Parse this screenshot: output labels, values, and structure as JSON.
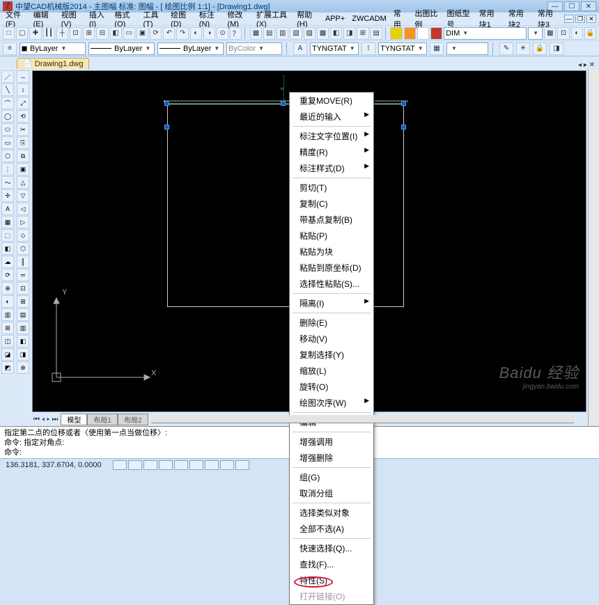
{
  "titlebar": {
    "app_icon": "Z",
    "title": "中望CAD机械版2014 - 主图幅  标准: 图幅 - [ 绘图比例 1:1] - [Drawing1.dwg]"
  },
  "menubar": {
    "items": [
      "文件(F)",
      "编辑(E)",
      "视图(V)",
      "插入(I)",
      "格式(O)",
      "工具(T)",
      "绘图(D)",
      "标注(N)",
      "修改(M)",
      "扩展工具(X)",
      "帮助(H)",
      "APP+",
      "ZWCADM",
      "常 用",
      "出图比例",
      "图纸型号",
      "常用块1",
      "常用块2",
      "常用块3"
    ]
  },
  "toolbar_row1": {
    "buttons": [
      "□",
      "▢",
      "✚",
      "┃┃",
      "┼",
      "⊡",
      "⊞",
      "⊟",
      "◧",
      "▭",
      "▣",
      "⟳",
      "↶",
      "↷",
      "◐",
      "◑",
      "⊙",
      "？"
    ],
    "buttons2": [
      "▦",
      "▤",
      "▥",
      "▧",
      "▨",
      "▩",
      "◧",
      "◨",
      "⊞",
      "▤"
    ],
    "combo1": "",
    "combo2": "DIM",
    "end_icons": [
      "▦",
      "⊡",
      "◐",
      "🔒"
    ]
  },
  "layer_row": {
    "combo_color": "ByLayer",
    "combo_ltype": "ByLayer",
    "combo_lweight": "ByLayer",
    "combo_color2": "ByColor",
    "combo_ts1": "TYNGTAT",
    "combo_ts2": "TYNGTAT",
    "layer_icons": [
      "✎",
      "☀",
      "🔒",
      "◨"
    ]
  },
  "doctab": {
    "name": "Drawing1.dwg"
  },
  "left_tools": [
    "／",
    "╲",
    "⌒",
    "◯",
    "⬭",
    "▭",
    "⬡",
    "⋮",
    "～",
    "✢",
    "A",
    "▦",
    "⬚",
    "◧",
    "☁",
    "⟳",
    "⊕",
    "◐",
    "▥",
    "⊞",
    "◫",
    "◪",
    "◩"
  ],
  "left_tools2": [
    "↔",
    "↕",
    "⤢",
    "⟲",
    "✂",
    "⎘",
    "⧉",
    "▣",
    "△",
    "▽",
    "◁",
    "▷",
    "◇",
    "⬡",
    "║",
    "═",
    "⊡",
    "⊞",
    "▤",
    "▥",
    "◧",
    "◨",
    "⊕"
  ],
  "bottom_tabs": {
    "model": "模型",
    "layout1": "布局1",
    "layout2": "布局2"
  },
  "command": {
    "line1": "指定第二点的位移或者〈使用第一点当做位移〉:",
    "line2": "命令: 指定对角点:",
    "line3": "命令:",
    "prompt": "命令:"
  },
  "status": {
    "coords": "136.3181, 337.6704, 0.0000"
  },
  "context_menu": {
    "items": [
      {
        "label": "重复MOVE(R)",
        "sub": false
      },
      {
        "label": "最近的输入",
        "sub": true
      },
      {
        "sep": true
      },
      {
        "label": "标注文字位置(I)",
        "sub": true
      },
      {
        "label": "精度(R)",
        "sub": true
      },
      {
        "label": "标注样式(D)",
        "sub": true
      },
      {
        "sep": true
      },
      {
        "label": "剪切(T)",
        "sub": false
      },
      {
        "label": "复制(C)",
        "sub": false
      },
      {
        "label": "带基点复制(B)",
        "sub": false
      },
      {
        "label": "粘贴(P)",
        "sub": false
      },
      {
        "label": "粘贴为块",
        "sub": false
      },
      {
        "label": "粘贴到原坐标(D)",
        "sub": false
      },
      {
        "label": "选择性粘贴(S)...",
        "sub": false
      },
      {
        "sep": true
      },
      {
        "label": "隔离(I)",
        "sub": true
      },
      {
        "sep": true
      },
      {
        "label": "删除(E)",
        "sub": false
      },
      {
        "label": "移动(V)",
        "sub": false
      },
      {
        "label": "复制选择(Y)",
        "sub": false
      },
      {
        "label": "缩放(L)",
        "sub": false
      },
      {
        "label": "旋转(O)",
        "sub": false
      },
      {
        "label": "绘图次序(W)",
        "sub": true
      },
      {
        "sep": true
      },
      {
        "label": "编辑",
        "sub": false
      },
      {
        "sep": true
      },
      {
        "label": "增强调用",
        "sub": false
      },
      {
        "label": "增强删除",
        "sub": false
      },
      {
        "sep": true
      },
      {
        "label": "组(G)",
        "sub": false
      },
      {
        "label": "取消分组",
        "sub": false
      },
      {
        "sep": true
      },
      {
        "label": "选择类似对象",
        "sub": false
      },
      {
        "label": "全部不选(A)",
        "sub": false
      },
      {
        "sep": true
      },
      {
        "label": "快速选择(Q)...",
        "sub": false
      },
      {
        "label": "查找(F)...",
        "sub": false
      },
      {
        "label": "特性(S)",
        "sub": false,
        "highlight": true
      },
      {
        "label": "打开链接(O)",
        "sub": false,
        "disabled": true
      }
    ]
  },
  "watermark": {
    "brand": "Baidu 经验",
    "url": "jingyan.baidu.com"
  },
  "ucs": {
    "x": "X",
    "y": "Y"
  }
}
